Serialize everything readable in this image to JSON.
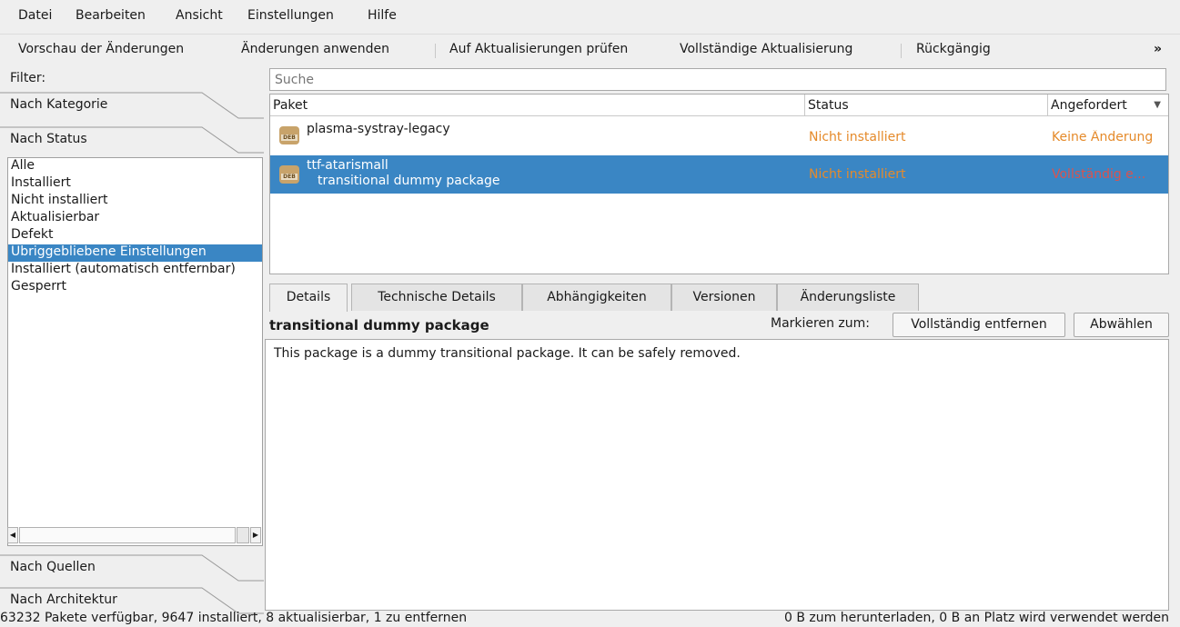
{
  "menu": {
    "items": [
      {
        "label": "Datei"
      },
      {
        "label": "Bearbeiten"
      },
      {
        "label": "Ansicht"
      },
      {
        "label": "Einstellungen"
      },
      {
        "label": "Hilfe"
      }
    ]
  },
  "toolbar": {
    "preview": "Vorschau der Änderungen",
    "apply": "Änderungen anwenden",
    "check_updates": "Auf Aktualisierungen prüfen",
    "full_upgrade": "Vollständige Aktualisierung",
    "undo": "Rückgängig",
    "more": "»"
  },
  "filter": {
    "label": "Filter:",
    "by_category": "Nach Kategorie",
    "by_status": "Nach Status",
    "by_origin": "Nach Quellen",
    "by_arch": "Nach Architektur",
    "status_items": [
      "Alle",
      "Installiert",
      "Nicht installiert",
      "Aktualisierbar",
      "Defekt",
      "Übriggebliebene Einstellungen",
      "Installiert (automatisch entfernbar)",
      "Gesperrt"
    ],
    "selected_status": "Übriggebliebene Einstellungen"
  },
  "search": {
    "placeholder": "Suche"
  },
  "table": {
    "columns": [
      "Paket",
      "Status",
      "Angefordert"
    ],
    "rows": [
      {
        "name": "plasma-systray-legacy",
        "desc": "",
        "status": "Nicht installiert",
        "requested": "Keine Änderung"
      },
      {
        "name": "ttf-atarismall",
        "desc": "transitional dummy package",
        "status": "Nicht installiert",
        "requested": "Vollständig e..."
      }
    ],
    "icon_text": "DEB"
  },
  "tabs": [
    "Details",
    "Technische Details",
    "Abhängigkeiten",
    "Versionen",
    "Änderungsliste"
  ],
  "details": {
    "title": "transitional dummy package",
    "mark_label": "Markieren zum:",
    "remove_button": "Vollständig entfernen",
    "deselect_button": "Abwählen",
    "description": "This package is a dummy transitional package. It can be safely removed."
  },
  "statusbar": {
    "left": "63232 Pakete verfügbar, 9647 installiert, 8 aktualisierbar, 1 zu entfernen",
    "right": "0 B zum herunterladen, 0 B an Platz wird verwendet werden"
  },
  "colors": {
    "selection": "#3a86c4",
    "status_orange": "#e58a2a",
    "requested_red": "#d9534f"
  }
}
